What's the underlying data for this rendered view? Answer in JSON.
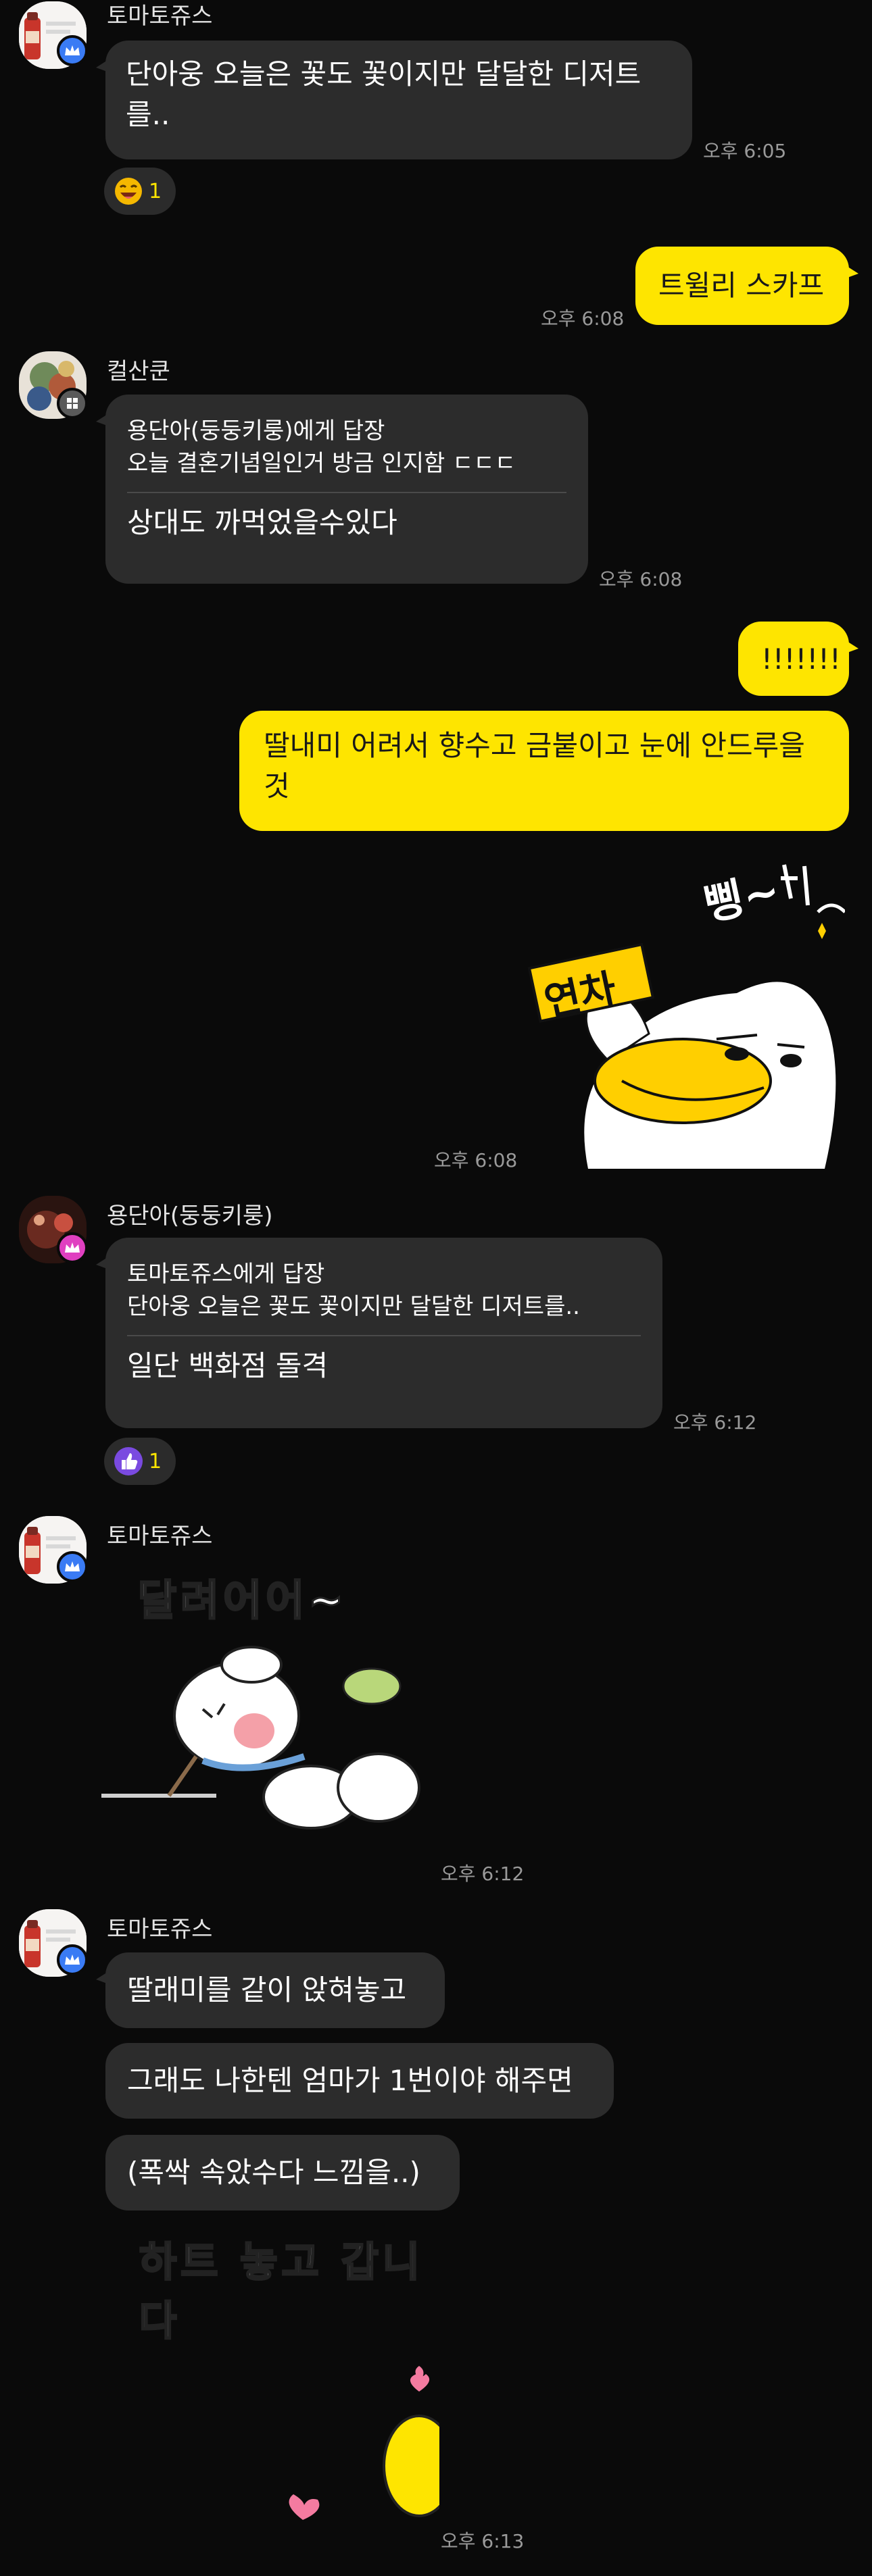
{
  "colors": {
    "background": "#0a0a0a",
    "bubble_other": "#2c2c2c",
    "bubble_mine": "#fee500",
    "reaction_count": "#fee500"
  },
  "messages": {
    "m1": {
      "sender": "토마토쥬스",
      "text_l1": "단아웅 오늘은 꽃도 꽃이지만 달달한 디저트",
      "text_l2": "를..",
      "time": "오후 6:05",
      "reaction": {
        "icon": "laughing-face-icon",
        "count": "1"
      }
    },
    "m2": {
      "text": "트윌리 스카프",
      "time": "오후 6:08"
    },
    "m3": {
      "sender": "컬산쿤",
      "reply_to": "용단아(둥둥키룽)에게 답장",
      "quoted": "오늘 결혼기념일인거 방금 인지함 ㄷㄷㄷ",
      "text": "상대도 까먹었을수있다",
      "time": "오후 6:08"
    },
    "m4": {
      "text": "!!!!!!!"
    },
    "m5": {
      "text_l1": "딸내미 어려서 향수고 금붙이고 눈에 안드루을",
      "text_l2": "것"
    },
    "m6": {
      "sticker_name": "duck-sticker",
      "sticker_text_bing": "삥~",
      "sticker_sign": "연차",
      "time": "오후 6:08"
    },
    "m7": {
      "sender": "용단아(둥둥키룽)",
      "reply_to": "토마토쥬스에게 답장",
      "quoted": "단아웅 오늘은 꽃도 꽃이지만 달달한 디저트를..",
      "text": "일단 백화점 돌격",
      "time": "오후 6:12",
      "reaction": {
        "icon": "thumbs-up-icon",
        "count": "1"
      }
    },
    "m8": {
      "sender": "토마토쥬스",
      "sticker_caption": "달려어어~",
      "sticker_name": "running-bunny-sticker",
      "time": "오후 6:12"
    },
    "m9": {
      "sender": "토마토쥬스",
      "b1": "딸래미를 같이 앉혀놓고",
      "b2": "그래도 나한텐 엄마가 1번이야 해주면",
      "b3": "(폭싹 속았수다 느낌을..)",
      "sticker_caption": "하트 놓고 갑니다",
      "sticker_name": "heart-chick-sticker",
      "time": "오후 6:13"
    }
  }
}
